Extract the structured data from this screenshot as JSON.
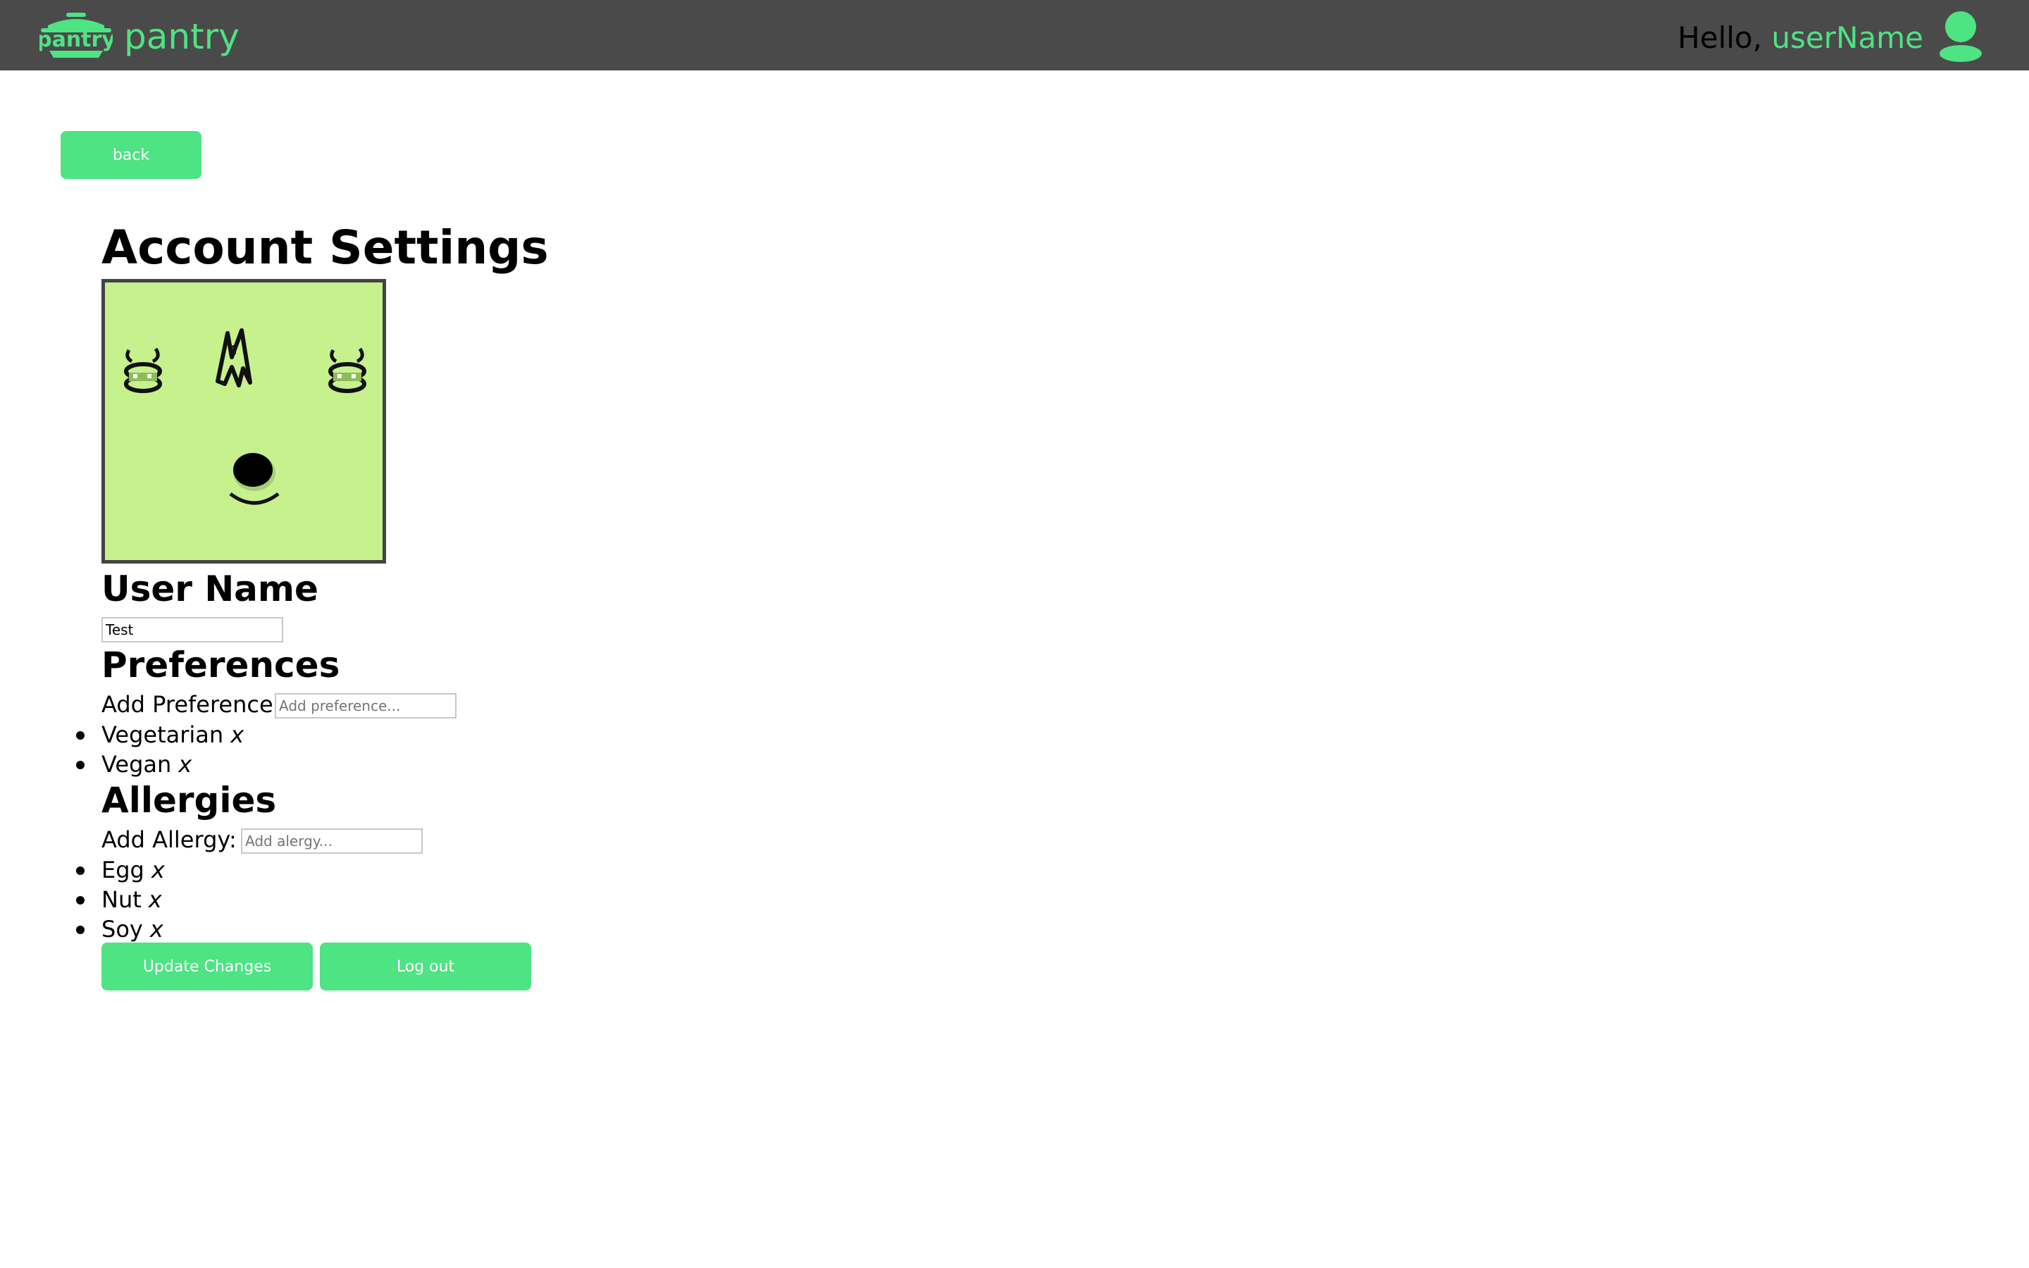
{
  "header": {
    "logo_icon_text": "pantry",
    "brand": "pantry",
    "greeting_prefix": "Hello, ",
    "username": "userName",
    "avatar_icon": "user-avatar-icon"
  },
  "back_button": "back",
  "page_title": "Account Settings",
  "avatar": {
    "icon": "monster-face-avatar",
    "background_color": "#c6f18d"
  },
  "user_name": {
    "heading": "User Name",
    "value": "Test"
  },
  "preferences": {
    "heading": "Preferences",
    "add_label": "Add Preference:",
    "placeholder": "Add preference...",
    "items": [
      {
        "label": "Vegetarian",
        "remove": "x"
      },
      {
        "label": "Vegan",
        "remove": "x"
      }
    ]
  },
  "allergies": {
    "heading": "Allergies",
    "add_label": "Add Allergy:",
    "placeholder": "Add alergy...",
    "items": [
      {
        "label": "Egg",
        "remove": "x"
      },
      {
        "label": "Nut",
        "remove": "x"
      },
      {
        "label": "Soy",
        "remove": "x"
      }
    ]
  },
  "actions": {
    "update": "Update Changes",
    "logout": "Log out"
  },
  "colors": {
    "accent": "#4ee383",
    "topbar": "#4a4a4a",
    "avatar_bg": "#c6f18d"
  }
}
